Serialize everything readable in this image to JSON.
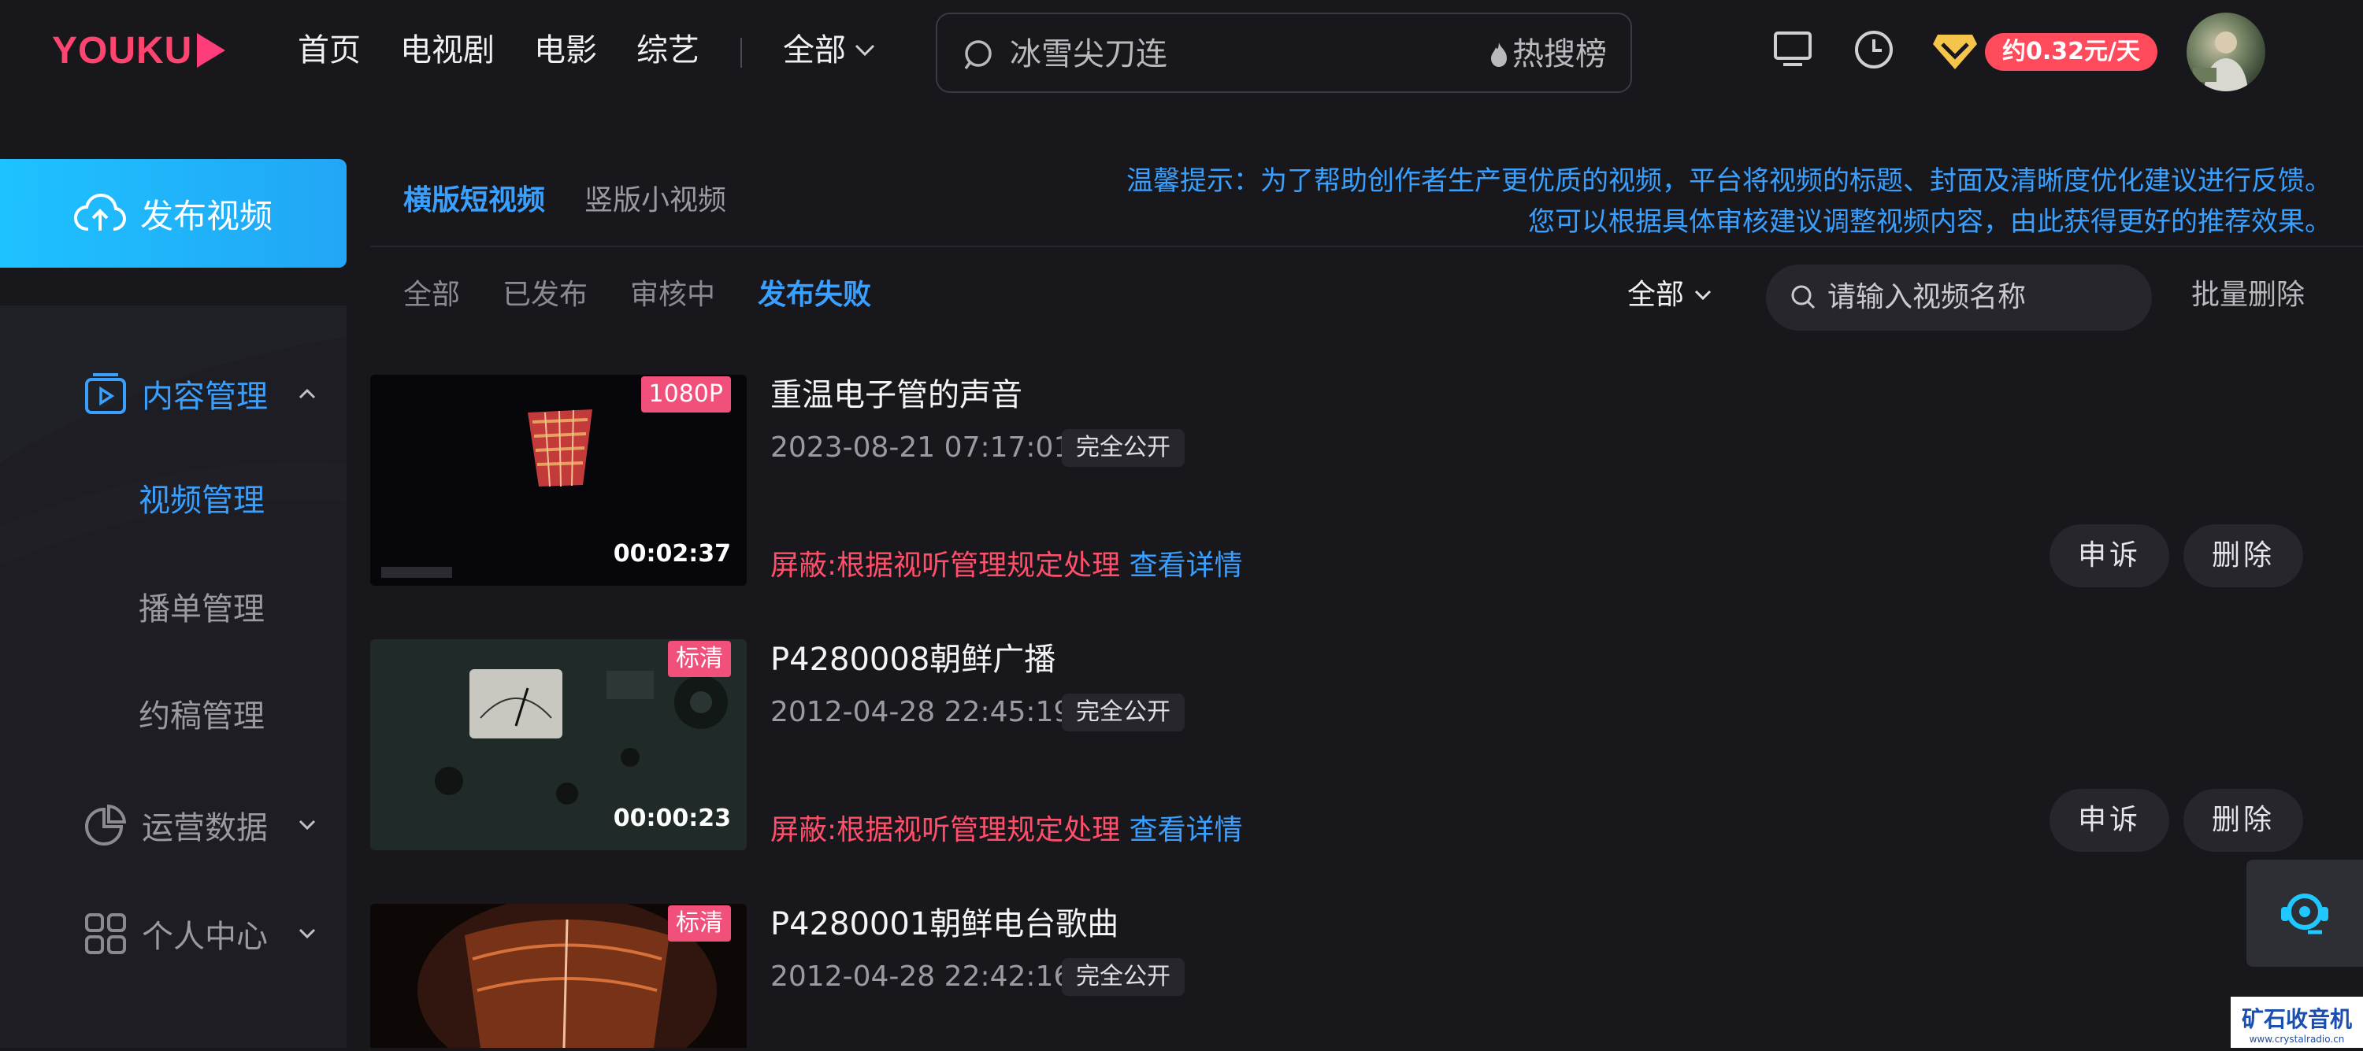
{
  "header": {
    "logo": "YOUKU",
    "nav": [
      "首页",
      "电视剧",
      "电影",
      "综艺"
    ],
    "nav_all": "全部",
    "search_placeholder": "冰雪尖刀连",
    "hot_search": "热搜榜",
    "vip_price": "约0.32元/天"
  },
  "sidebar": {
    "publish_label": "发布视频",
    "content_mgmt": "内容管理",
    "sub_items": [
      "视频管理",
      "播单管理",
      "约稿管理"
    ],
    "ops_data": "运营数据",
    "personal_center": "个人中心"
  },
  "main": {
    "tabs": [
      "横版短视频",
      "竖版小视频"
    ],
    "notice_line1": "温馨提示：为了帮助创作者生产更优质的视频，平台将视频的标题、封面及清晰度优化建议进行反馈。",
    "notice_line2": "您可以根据具体审核建议调整视频内容，由此获得更好的推荐效果。",
    "filters": [
      "全部",
      "已发布",
      "审核中",
      "发布失败"
    ],
    "dropdown_all": "全部",
    "search_placeholder": "请输入视频名称",
    "batch_delete": "批量删除",
    "videos": [
      {
        "quality": "1080P",
        "duration": "00:02:37",
        "title": "重温电子管的声音",
        "date": "2023-08-21 07:17:01",
        "visibility": "完全公开",
        "blocked": "屏蔽:根据视听管理规定处理",
        "detail": "查看详情",
        "appeal": "申诉",
        "delete": "删除"
      },
      {
        "quality": "标清",
        "duration": "00:00:23",
        "title": "P4280008朝鲜广播",
        "date": "2012-04-28 22:45:19",
        "visibility": "完全公开",
        "blocked": "屏蔽:根据视听管理规定处理",
        "detail": "查看详情",
        "appeal": "申诉",
        "delete": "删除"
      },
      {
        "quality": "标清",
        "title": "P4280001朝鲜电台歌曲",
        "date": "2012-04-28 22:42:16",
        "visibility": "完全公开"
      }
    ]
  },
  "watermark": {
    "logo_text": "矿石收音机",
    "url": "www.crystalradio.cn"
  },
  "colors": {
    "background": "#17171c",
    "accent_blue": "#3aa0ff",
    "publish_gradient_start": "#1ec2ff",
    "blocked_red": "#ff4f6a",
    "badge_pink": "#f0507a",
    "vip_red": "#ff4b5b"
  }
}
